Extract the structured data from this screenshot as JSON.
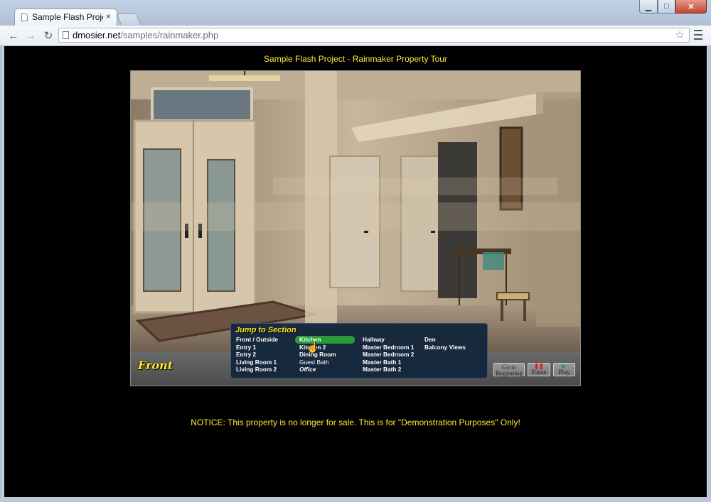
{
  "browser": {
    "tab_title": "Sample Flash Project - Rai",
    "tab_close": "×",
    "url_host": "dmosier.net",
    "url_path": "/samples/rainmaker.php",
    "win_minimize": "▁",
    "win_maximize": "□",
    "win_close": "✕"
  },
  "page": {
    "title": "Sample Flash Project - Rainmaker Property Tour",
    "notice": "NOTICE:   This property is no longer for sale. This is for \"Demonstration Purposes\" Only!"
  },
  "tour": {
    "current_room": "Front",
    "jump_title": "Jump to Section",
    "columns": [
      [
        "Front / Outside",
        "Entry 1",
        "Entry 2",
        "Living Room 1",
        "Living Room 2"
      ],
      [
        "Kitchen",
        "Kitchen 2",
        "Dining Room",
        "Guest Bath",
        "Office"
      ],
      [
        "Hallway",
        "Master Bedroom 1",
        "Master Bedroom 2",
        "Master Bath 1",
        "Master Bath 2"
      ],
      [
        "Den",
        "Balcony Views"
      ]
    ],
    "highlighted": "Kitchen",
    "controls": {
      "goto_line1": "Go to",
      "goto_line2": "Beginning",
      "pause_glyph": "❚❚",
      "pause": "Pause",
      "play_glyph": "▶",
      "play": "Play"
    },
    "cursor_glyph": "☝",
    "colors": {
      "accent_yellow": "#ffe73a",
      "menu_panel": "#14263c",
      "highlight_green": "#2a9a3a"
    }
  }
}
